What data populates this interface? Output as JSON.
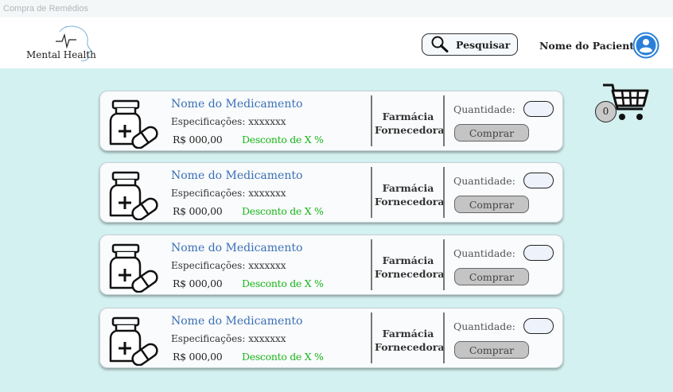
{
  "window": {
    "title": "Compra de Remédios"
  },
  "header": {
    "logo_text": "Mental Health",
    "search_label": "Pesquisar",
    "patient_name": "Nome do Paciente"
  },
  "cart": {
    "count": "0"
  },
  "products": [
    {
      "name": "Nome do Medicamento",
      "spec": "Especificações: xxxxxxx",
      "price": "R$ 000,00",
      "discount": "Desconto de X %",
      "pharmacy_line1": "Farmácia",
      "pharmacy_line2": "Fornecedora",
      "quantity_label": "Quantidade:",
      "quantity_value": "",
      "buy_label": "Comprar"
    },
    {
      "name": "Nome do Medicamento",
      "spec": "Especificações: xxxxxxx",
      "price": "R$ 000,00",
      "discount": "Desconto de X %",
      "pharmacy_line1": "Farmácia",
      "pharmacy_line2": "Fornecedora",
      "quantity_label": "Quantidade:",
      "quantity_value": "",
      "buy_label": "Comprar"
    },
    {
      "name": "Nome do Medicamento",
      "spec": "Especificações: xxxxxxx",
      "price": "R$ 000,00",
      "discount": "Desconto de X %",
      "pharmacy_line1": "Farmácia",
      "pharmacy_line2": "Fornecedora",
      "quantity_label": "Quantidade:",
      "quantity_value": "",
      "buy_label": "Comprar"
    },
    {
      "name": "Nome do Medicamento",
      "spec": "Especificações: xxxxxxx",
      "price": "R$ 000,00",
      "discount": "Desconto de X %",
      "pharmacy_line1": "Farmácia",
      "pharmacy_line2": "Fornecedora",
      "quantity_label": "Quantidade:",
      "quantity_value": "",
      "buy_label": "Comprar"
    }
  ],
  "icons": {
    "logo": "head-heartbeat-icon",
    "search": "search-icon",
    "avatar": "user-avatar-icon",
    "cart": "shopping-cart-icon",
    "product": "medicine-bottle-pill-icon"
  },
  "colors": {
    "background": "#d4f1f1",
    "accent_blue": "#3a6fb5",
    "discount_green": "#1bb51b",
    "avatar_blue": "#2a80d8"
  }
}
